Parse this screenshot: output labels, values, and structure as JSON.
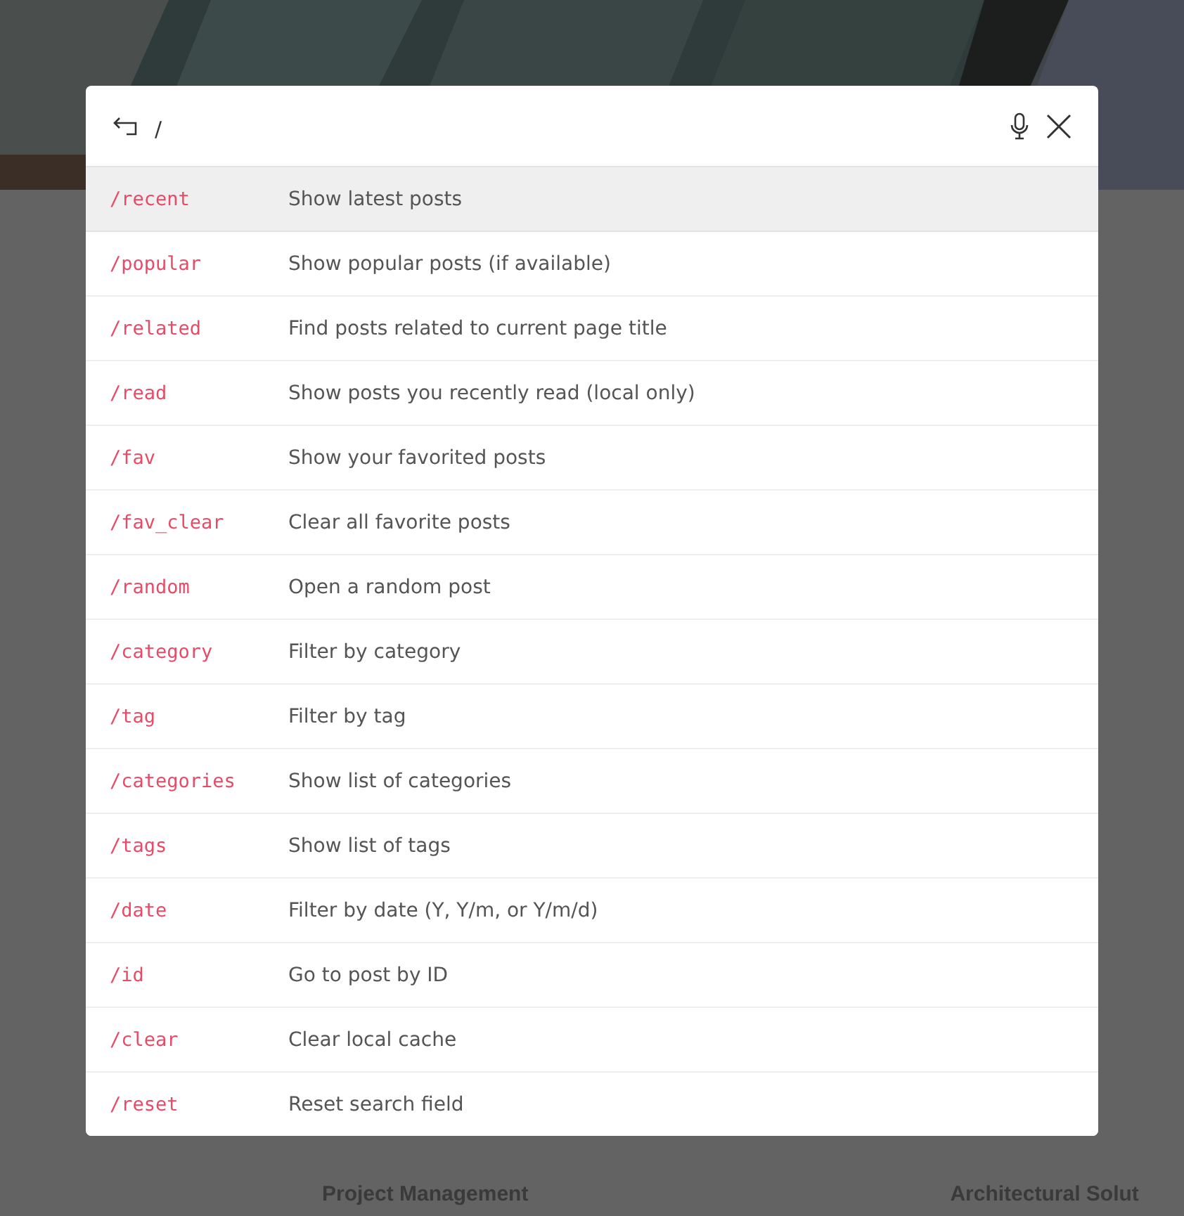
{
  "background": {
    "card_titles": [
      "Project Management",
      "Architectural Solut"
    ]
  },
  "search": {
    "value": "/"
  },
  "commands": [
    {
      "command": "/recent",
      "description": "Show latest posts",
      "selected": true
    },
    {
      "command": "/popular",
      "description": "Show popular posts (if available)",
      "selected": false
    },
    {
      "command": "/related",
      "description": "Find posts related to current page title",
      "selected": false
    },
    {
      "command": "/read",
      "description": "Show posts you recently read (local only)",
      "selected": false
    },
    {
      "command": "/fav",
      "description": "Show your favorited posts",
      "selected": false
    },
    {
      "command": "/fav_clear",
      "description": "Clear all favorite posts",
      "selected": false
    },
    {
      "command": "/random",
      "description": "Open a random post",
      "selected": false
    },
    {
      "command": "/category",
      "description": "Filter by category",
      "selected": false
    },
    {
      "command": "/tag",
      "description": "Filter by tag",
      "selected": false
    },
    {
      "command": "/categories",
      "description": "Show list of categories",
      "selected": false
    },
    {
      "command": "/tags",
      "description": "Show list of tags",
      "selected": false
    },
    {
      "command": "/date",
      "description": "Filter by date (Y, Y/m, or Y/m/d)",
      "selected": false
    },
    {
      "command": "/id",
      "description": "Go to post by ID",
      "selected": false
    },
    {
      "command": "/clear",
      "description": "Clear local cache",
      "selected": false
    },
    {
      "command": "/reset",
      "description": "Reset search field",
      "selected": false
    }
  ]
}
